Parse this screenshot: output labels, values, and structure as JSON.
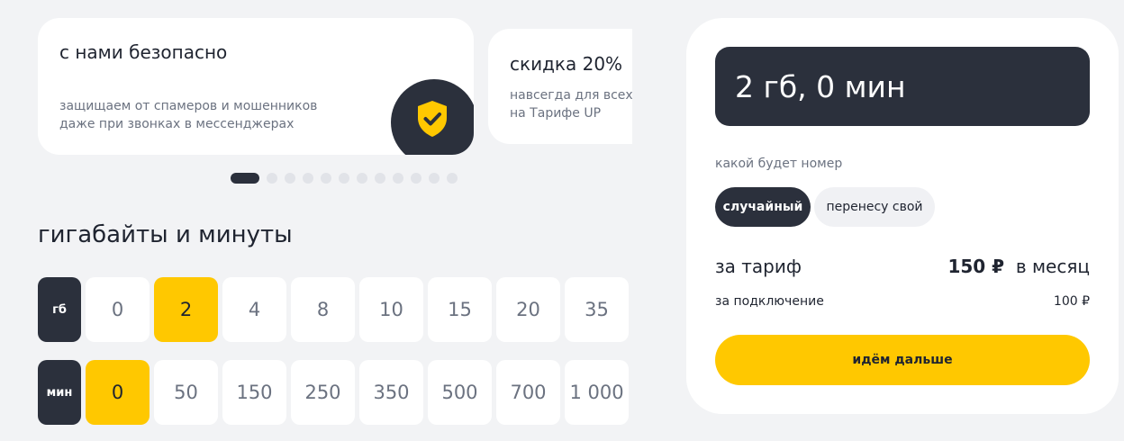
{
  "promo_cards": [
    {
      "title": "с нами безопасно",
      "text": "защищаем от спамеров и мошенников даже при звонках в мессенджерах",
      "icon": "shield-check-icon"
    },
    {
      "title": "скидка 20%",
      "text_line1": "навсегда для всех к",
      "text_line2": "на Тарифе UP"
    }
  ],
  "carousel": {
    "total_dots": 12,
    "active_index": 0
  },
  "selector": {
    "title": "гигабайты и минуты",
    "gb": {
      "label": "гб",
      "options": [
        "0",
        "2",
        "4",
        "8",
        "10",
        "15",
        "20",
        "35"
      ],
      "selected": "2"
    },
    "min": {
      "label": "мин",
      "options": [
        "0",
        "50",
        "150",
        "250",
        "350",
        "500",
        "700",
        "1 000"
      ],
      "selected": "0"
    }
  },
  "summary": {
    "plan": "2 гб, 0 мин",
    "number_label": "какой будет номер",
    "number_options": {
      "random": "случайный",
      "transfer": "перенесу свой"
    },
    "tariff_label": "за тариф",
    "tariff_price": "150 ₽",
    "tariff_period": "в месяц",
    "connect_label": "за подключение",
    "connect_price": "100 ₽",
    "continue_label": "идём дальше"
  },
  "colors": {
    "accent": "#ffc800",
    "dark": "#2b303c",
    "background": "#f2f3f5"
  }
}
